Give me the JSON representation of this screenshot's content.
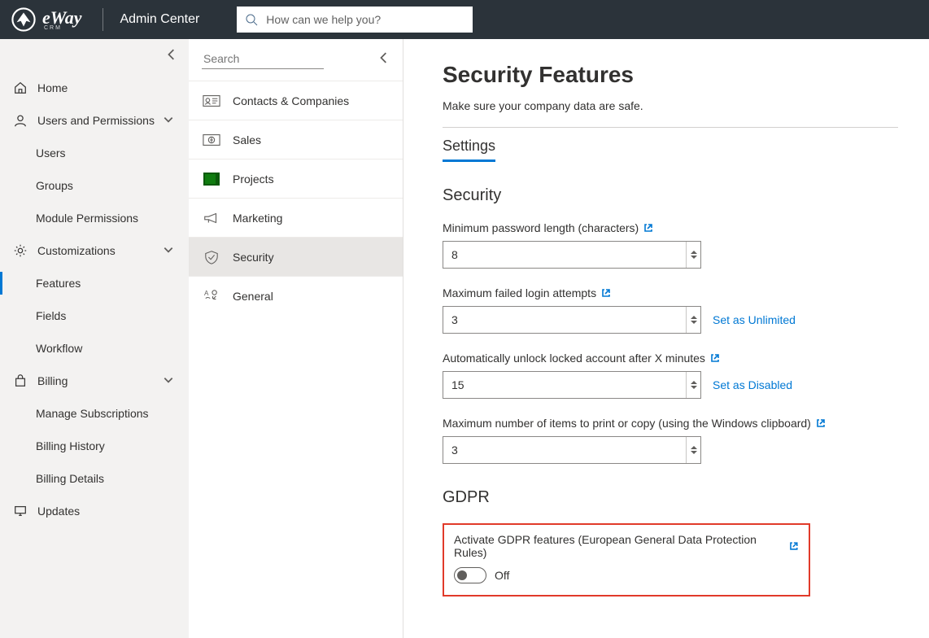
{
  "header": {
    "logo_brand": "eWay",
    "logo_sub": "CRM",
    "title": "Admin Center",
    "search_placeholder": "How can we help you?"
  },
  "sidebar": {
    "items": [
      {
        "label": "Home",
        "icon": "home-icon"
      },
      {
        "label": "Users and Permissions",
        "icon": "user-icon",
        "expandable": true,
        "children": [
          {
            "label": "Users"
          },
          {
            "label": "Groups"
          },
          {
            "label": "Module Permissions"
          }
        ]
      },
      {
        "label": "Customizations",
        "icon": "gear-icon",
        "expandable": true,
        "children": [
          {
            "label": "Features",
            "selected": true
          },
          {
            "label": "Fields"
          },
          {
            "label": "Workflow"
          }
        ]
      },
      {
        "label": "Billing",
        "icon": "bag-icon",
        "expandable": true,
        "children": [
          {
            "label": "Manage Subscriptions"
          },
          {
            "label": "Billing History"
          },
          {
            "label": "Billing Details"
          }
        ]
      },
      {
        "label": "Updates",
        "icon": "monitor-icon"
      }
    ]
  },
  "secondary_panel": {
    "search_placeholder": "Search",
    "items": [
      {
        "label": "Contacts & Companies",
        "icon": "contacts-icon"
      },
      {
        "label": "Sales",
        "icon": "sales-icon"
      },
      {
        "label": "Projects",
        "icon": "projects-icon"
      },
      {
        "label": "Marketing",
        "icon": "marketing-icon"
      },
      {
        "label": "Security",
        "icon": "security-icon",
        "selected": true
      },
      {
        "label": "General",
        "icon": "general-icon"
      }
    ]
  },
  "main": {
    "title": "Security Features",
    "subtitle": "Make sure your company data are safe.",
    "tab": "Settings",
    "security_heading": "Security",
    "fields": {
      "pwd_len_label": "Minimum password length (characters)",
      "pwd_len_value": "8",
      "failed_attempts_label": "Maximum failed login attempts",
      "failed_attempts_value": "3",
      "failed_attempts_action": "Set as Unlimited",
      "unlock_label": "Automatically unlock locked account after X minutes",
      "unlock_value": "15",
      "unlock_action": "Set as Disabled",
      "clipboard_label": "Maximum number of items to print or copy (using the Windows clipboard)",
      "clipboard_value": "3"
    },
    "gdpr_heading": "GDPR",
    "gdpr_label": "Activate GDPR features (European General Data Protection Rules)",
    "gdpr_state": "Off"
  }
}
